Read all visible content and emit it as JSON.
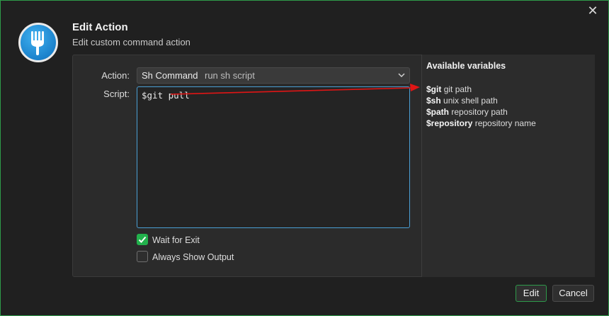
{
  "dialog": {
    "title": "Edit Action",
    "subtitle": "Edit custom command action"
  },
  "form": {
    "action_label": "Action:",
    "action_value": "Sh Command",
    "action_description": "run sh script",
    "script_label": "Script:",
    "script_value": "$git pull",
    "wait_for_exit_label": "Wait for Exit",
    "wait_for_exit_checked": true,
    "always_show_output_label": "Always Show Output",
    "always_show_output_checked": false
  },
  "variables": {
    "title": "Available variables",
    "items": [
      {
        "name": "$git",
        "desc": "git path"
      },
      {
        "name": "$sh",
        "desc": "unix shell path"
      },
      {
        "name": "$path",
        "desc": "repository path"
      },
      {
        "name": "$repository",
        "desc": "repository name"
      }
    ]
  },
  "buttons": {
    "edit": "Edit",
    "cancel": "Cancel"
  },
  "icons": {
    "close": "close-icon",
    "app": "fork-icon",
    "dropdown": "chevron-down-icon",
    "check": "checkmark-icon"
  },
  "colors": {
    "accent_green": "#22b14c",
    "window_border": "#2e9a4a",
    "focus_blue": "#4a9fd4",
    "annotation_arrow": "#e01515"
  }
}
